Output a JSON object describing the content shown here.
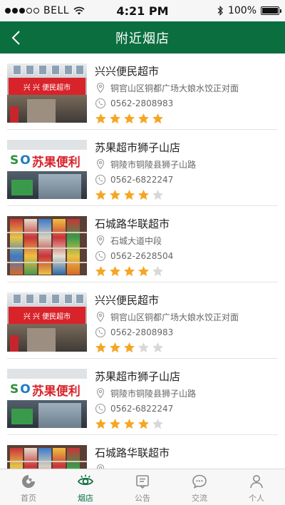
{
  "status": {
    "carrier": "BELL",
    "time": "4:21 PM",
    "battery": "100%",
    "signal_bars": 5,
    "signal_filled": 3
  },
  "nav": {
    "title": "附近烟店"
  },
  "colors": {
    "brand": "#0b6e3f",
    "star_on": "#f5a623",
    "star_off": "#d8d8d8"
  },
  "stores": [
    {
      "name": "兴兴便民超市",
      "address": "铜官山区铜都广场大娘水饺正对面",
      "phone": "0562-2808983",
      "rating": 5,
      "sign": "兴 兴  便民超市"
    },
    {
      "name": "苏果超市狮子山店",
      "address": "铜陵市铜陵县狮子山路",
      "phone": "0562-6822247",
      "rating": 4,
      "sign": "苏果便利"
    },
    {
      "name": "石城路华联超市",
      "address": "石城大道中段",
      "phone": "0562-2628504",
      "rating": 4
    },
    {
      "name": "兴兴便民超市",
      "address": "铜官山区铜都广场大娘水饺正对面",
      "phone": "0562-2808983",
      "rating": 3,
      "sign": "兴 兴  便民超市"
    },
    {
      "name": "苏果超市狮子山店",
      "address": "铜陵市铜陵县狮子山路",
      "phone": "0562-6822247",
      "rating": 4,
      "sign": "苏果便利"
    },
    {
      "name": "石城路华联超市",
      "address": "",
      "phone": "",
      "rating": 0
    }
  ],
  "tabs": [
    {
      "label": "首页",
      "icon": "home-logo-icon",
      "active": false
    },
    {
      "label": "烟店",
      "icon": "eye-icon",
      "active": true
    },
    {
      "label": "公告",
      "icon": "notice-icon",
      "active": false
    },
    {
      "label": "交流",
      "icon": "chat-icon",
      "active": false
    },
    {
      "label": "个人",
      "icon": "user-icon",
      "active": false
    }
  ]
}
